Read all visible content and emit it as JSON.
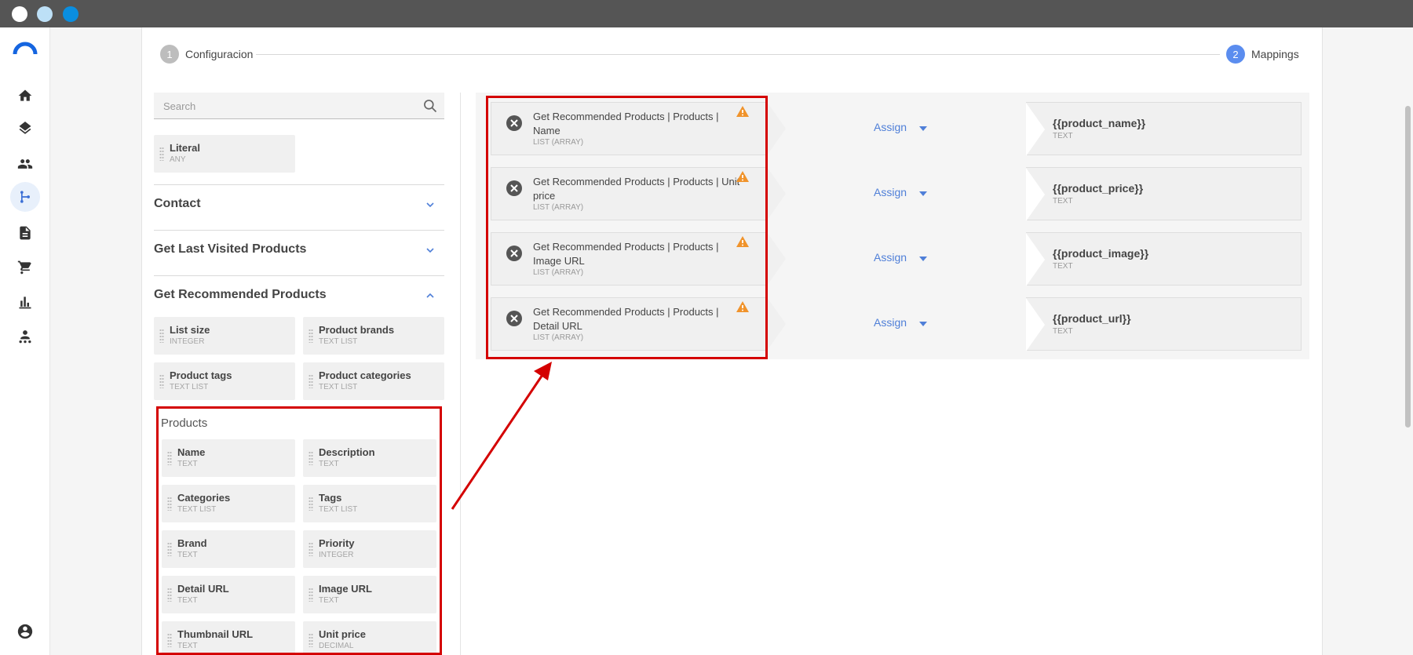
{
  "window": {
    "traffic_lights": [
      "#ffffff",
      "#bde0f7",
      "#0a8ee0"
    ]
  },
  "sidebar": {
    "items": [
      {
        "icon": "home-icon"
      },
      {
        "icon": "layers-icon"
      },
      {
        "icon": "people-icon"
      },
      {
        "icon": "flow-icon",
        "active": true
      },
      {
        "icon": "document-icon"
      },
      {
        "icon": "cart-icon"
      },
      {
        "icon": "bar-chart-icon"
      },
      {
        "icon": "user-group-icon"
      }
    ],
    "account_icon": "account-circle-icon"
  },
  "stepper": {
    "step1": {
      "number": "1",
      "label": "Configuracion"
    },
    "step2": {
      "number": "2",
      "label": "Mappings"
    }
  },
  "search": {
    "placeholder": "Search"
  },
  "literal": {
    "name": "Literal",
    "type": "ANY"
  },
  "sections": {
    "contact": "Contact",
    "last_visited": "Get Last Visited Products",
    "recommended": "Get Recommended Products"
  },
  "recommended_fields": [
    {
      "name": "List size",
      "type": "INTEGER"
    },
    {
      "name": "Product brands",
      "type": "TEXT LIST"
    },
    {
      "name": "Product tags",
      "type": "TEXT LIST"
    },
    {
      "name": "Product categories",
      "type": "TEXT LIST"
    }
  ],
  "products": {
    "title": "Products",
    "fields": [
      {
        "name": "Name",
        "type": "TEXT"
      },
      {
        "name": "Description",
        "type": "TEXT"
      },
      {
        "name": "Categories",
        "type": "TEXT LIST"
      },
      {
        "name": "Tags",
        "type": "TEXT LIST"
      },
      {
        "name": "Brand",
        "type": "TEXT"
      },
      {
        "name": "Priority",
        "type": "INTEGER"
      },
      {
        "name": "Detail URL",
        "type": "TEXT"
      },
      {
        "name": "Image URL",
        "type": "TEXT"
      },
      {
        "name": "Thumbnail URL",
        "type": "TEXT"
      },
      {
        "name": "Unit price",
        "type": "DECIMAL"
      }
    ]
  },
  "mappings": [
    {
      "source": "Get Recommended Products | Products | Name",
      "source_type": "LIST (ARRAY)",
      "action": "Assign",
      "target": "{{product_name}}",
      "target_type": "TEXT"
    },
    {
      "source": "Get Recommended Products | Products | Unit price",
      "source_type": "LIST (ARRAY)",
      "action": "Assign",
      "target": "{{product_price}}",
      "target_type": "TEXT"
    },
    {
      "source": "Get Recommended Products | Products | Image URL",
      "source_type": "LIST (ARRAY)",
      "action": "Assign",
      "target": "{{product_image}}",
      "target_type": "TEXT"
    },
    {
      "source": "Get Recommended Products | Products | Detail URL",
      "source_type": "LIST (ARRAY)",
      "action": "Assign",
      "target": "{{product_url}}",
      "target_type": "TEXT"
    }
  ],
  "colors": {
    "accent": "#4f7fd8",
    "annotation_red": "#d40000",
    "warning": "#f0932b"
  }
}
